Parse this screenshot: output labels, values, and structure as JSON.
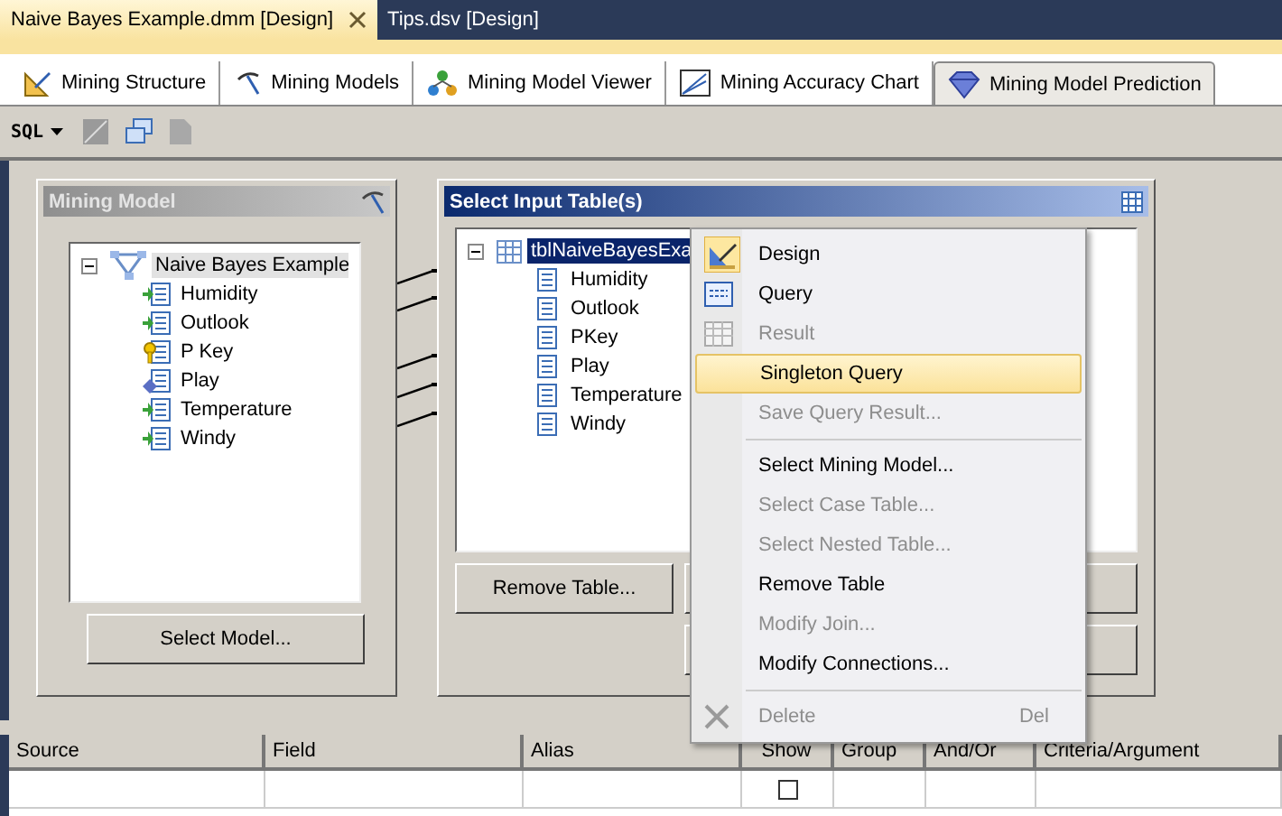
{
  "document_tabs": [
    {
      "label": "Naive Bayes Example.dmm [Design]",
      "selected": true,
      "closable": true
    },
    {
      "label": "Tips.dsv [Design]",
      "selected": false,
      "closable": false
    }
  ],
  "designer_tabs": [
    {
      "label": "Mining Structure",
      "selected": false
    },
    {
      "label": "Mining Models",
      "selected": false
    },
    {
      "label": "Mining Model Viewer",
      "selected": false
    },
    {
      "label": "Mining Accuracy Chart",
      "selected": false
    },
    {
      "label": "Mining Model Prediction",
      "selected": true
    }
  ],
  "toolbar": {
    "sql_button": "SQL"
  },
  "mining_model": {
    "title": "Mining Model",
    "model": {
      "label": "Naive Bayes Example",
      "expanded": true,
      "children": [
        {
          "label": "Humidity",
          "kind": "input"
        },
        {
          "label": "Outlook",
          "kind": "input"
        },
        {
          "label": "P Key",
          "kind": "key"
        },
        {
          "label": "Play",
          "kind": "predict"
        },
        {
          "label": "Temperature",
          "kind": "input"
        },
        {
          "label": "Windy",
          "kind": "input"
        }
      ]
    },
    "button": "Select Model..."
  },
  "input_table": {
    "title": "Select Input Table(s)",
    "table": {
      "label": "tblNaiveBayesExa",
      "expanded": true,
      "selected": true,
      "children": [
        {
          "label": "Humidity"
        },
        {
          "label": "Outlook"
        },
        {
          "label": "PKey"
        },
        {
          "label": "Play"
        },
        {
          "label": "Temperature"
        },
        {
          "label": "Windy"
        }
      ]
    },
    "button": "Remove Table..."
  },
  "context_menu": [
    {
      "label": "Design",
      "disabled": false,
      "selected": false
    },
    {
      "label": "Query",
      "disabled": false,
      "selected": false
    },
    {
      "label": "Result",
      "disabled": true,
      "selected": false
    },
    {
      "label": "Singleton Query",
      "disabled": false,
      "selected": true
    },
    {
      "label": "Save Query Result...",
      "disabled": true,
      "selected": false
    },
    {
      "label": "Select Mining Model...",
      "disabled": false,
      "selected": false,
      "separator_before": true
    },
    {
      "label": "Select Case Table...",
      "disabled": true,
      "selected": false
    },
    {
      "label": "Select Nested Table...",
      "disabled": true,
      "selected": false
    },
    {
      "label": "Remove Table",
      "disabled": false,
      "selected": false
    },
    {
      "label": "Modify Join...",
      "disabled": true,
      "selected": false
    },
    {
      "label": "Modify Connections...",
      "disabled": false,
      "selected": false
    },
    {
      "label": "Delete",
      "disabled": true,
      "selected": false,
      "separator_before": true,
      "shortcut": "Del"
    }
  ],
  "grid": {
    "columns": [
      "Source",
      "Field",
      "Alias",
      "Show",
      "Group",
      "And/Or",
      "Criteria/Argument"
    ],
    "rows": [
      {
        "show": false
      }
    ]
  }
}
